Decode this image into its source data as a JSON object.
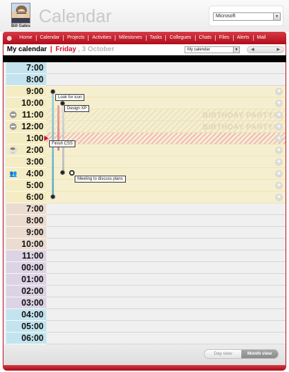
{
  "header": {
    "user_name": "Bill Gates",
    "app_title": "Calendar",
    "company_selected": "Microsoft"
  },
  "nav": {
    "items": [
      "Home",
      "Calendar",
      "Projects",
      "Activities",
      "Milestones",
      "Tasks",
      "Collegues",
      "Chats",
      "Files",
      "Alerts",
      "Mail"
    ]
  },
  "titlebar": {
    "title": "My calendar",
    "separator": "|",
    "day": "Friday",
    "date": ", 3 October",
    "view_selected": "My calendar",
    "prev_icon": "arrow-left-icon",
    "next_icon": "arrow-right-icon"
  },
  "schedule": {
    "hours": [
      "7:00",
      "8:00",
      "9:00",
      "10:00",
      "11:00",
      "12:00",
      "1:00",
      "2:00",
      "3:00",
      "4:00",
      "5:00",
      "6:00",
      "7:00",
      "8:00",
      "9:00",
      "10:00",
      "11:00",
      "00:00",
      "01:00",
      "02:00",
      "03:00",
      "04:00",
      "05:00",
      "06:00"
    ],
    "events": {
      "look_for_icon": "Look for icon",
      "design_xp": "Design XP",
      "finish_css": "Finish CSS",
      "meeting": "Meeting to discuss plans",
      "birthday_1": "BIRTHDAY PARTY!",
      "birthday_2": "BIRTHDAY PARTY!"
    },
    "colors": {
      "morning": "#c3e4ee",
      "work": "#f4ecc2",
      "evening": "#ecdcd0",
      "night": "#dcd3e4",
      "accent": "#d2122e"
    }
  },
  "footer": {
    "day_view": "Day view",
    "month_view": "Month view"
  }
}
